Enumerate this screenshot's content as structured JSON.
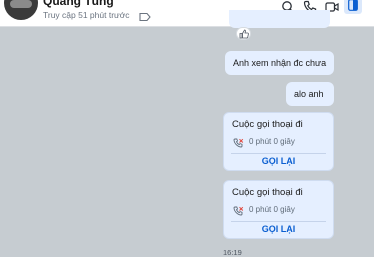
{
  "header": {
    "contact_name": "Quang Tùng",
    "status": "Truy cập 51 phút trước"
  },
  "messages": [
    {
      "type": "text",
      "text": "Anh xem nhận đc chưa"
    },
    {
      "type": "text",
      "text": "alo anh"
    },
    {
      "type": "call",
      "title": "Cuộc gọi thoại đi",
      "duration": "0 phút 0 giây",
      "action": "GỌI LẠI"
    },
    {
      "type": "call",
      "title": "Cuộc gọi thoại đi",
      "duration": "0 phút 0 giây",
      "action": "GỌI LẠI"
    }
  ],
  "last_time": "16:19",
  "colors": {
    "outgoing_bubble": "#e5efff",
    "accent": "#0b5fd1",
    "missed_call": "#e0463b",
    "chat_background": "#c6ccd1"
  },
  "icons": {
    "tag": "tag-icon",
    "search": "search-icon",
    "voice_call": "phone-icon",
    "video_call": "video-icon",
    "panel": "panel-toggle-icon",
    "reaction": "like-icon",
    "call_status": "missed-call-icon"
  }
}
